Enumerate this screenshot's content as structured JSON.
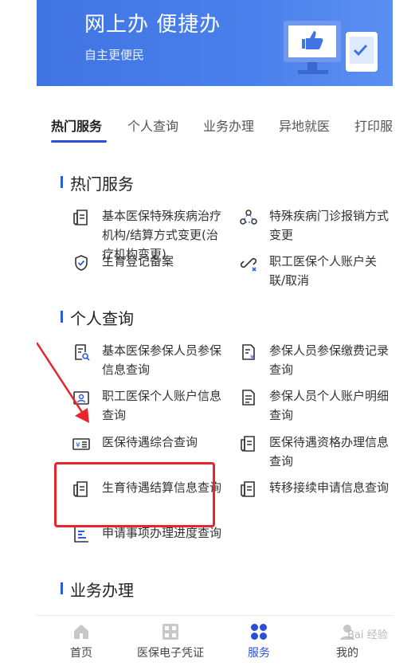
{
  "banner": {
    "title": "网上办 便捷办",
    "subtitle": "自主更便民"
  },
  "tabs": [
    {
      "label": "热门服务",
      "active": true
    },
    {
      "label": "个人查询"
    },
    {
      "label": "业务办理"
    },
    {
      "label": "异地就医"
    },
    {
      "label": "打印服"
    }
  ],
  "sections": {
    "hot": {
      "title": "热门服务",
      "items": [
        {
          "label": "基本医保特殊疾病治疗机构/结算方式变更(治疗机构变更)",
          "icon": "document-icon"
        },
        {
          "label": "特殊疾病门诊报销方式变更",
          "icon": "network-icon"
        },
        {
          "label": "生育登记备案",
          "icon": "shield-check-icon"
        },
        {
          "label": "职工医保个人账户关联/取消",
          "icon": "unlink-icon"
        }
      ]
    },
    "personal": {
      "title": "个人查询",
      "items": [
        {
          "label": "基本医保参保人员参保信息查询",
          "icon": "doc-search-icon"
        },
        {
          "label": "参保人员参保缴费记录查询",
          "icon": "doc-yen-icon"
        },
        {
          "label": "职工医保个人账户信息查询",
          "icon": "id-card-icon"
        },
        {
          "label": "参保人员个人账户明细查询",
          "icon": "doc-lines-icon"
        },
        {
          "label": "医保待遇综合查询",
          "icon": "yen-card-icon"
        },
        {
          "label": "医保待遇资格办理信息查询",
          "icon": "document-icon"
        },
        {
          "label": "生育待遇结算信息查询",
          "icon": "document-icon"
        },
        {
          "label": "转移接续申请信息查询",
          "icon": "document-icon"
        },
        {
          "label": "申请事项办理进度查询",
          "icon": "progress-chart-icon"
        }
      ]
    },
    "business": {
      "title": "业务办理"
    }
  },
  "bottom_nav": [
    {
      "label": "首页",
      "icon": "home-icon"
    },
    {
      "label": "医保电子凭证",
      "icon": "qr-code-icon"
    },
    {
      "label": "服务",
      "icon": "grid-icon",
      "active": true
    },
    {
      "label": "我的",
      "icon": "user-icon"
    }
  ],
  "watermark": "Bai 经验",
  "colors": {
    "accent": "#2a4fd6",
    "banner": "#4a80ec",
    "highlight": "#e6262b"
  }
}
